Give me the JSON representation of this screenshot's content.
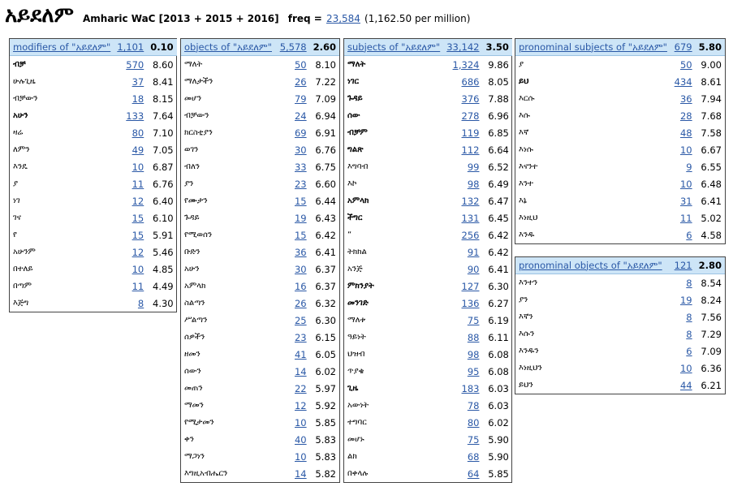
{
  "header": {
    "headword": "አይደለም",
    "corpus": "Amharic WaC [2013 + 2015 + 2016]",
    "freq_label": "freq =",
    "freq_value": "23,584",
    "per_million": "(1,162.50 per million)"
  },
  "panels": [
    {
      "title": "modifiers of \"አይደለም\"",
      "count": "1,101",
      "score": "0.10",
      "rows": [
        {
          "word": "ብቻ",
          "freq": "570",
          "score": "8.60",
          "bold": true
        },
        {
          "word": "ሁሉጊዜ",
          "freq": "37",
          "score": "8.41",
          "bold": false
        },
        {
          "word": "ብቻውን",
          "freq": "18",
          "score": "8.15",
          "bold": false
        },
        {
          "word": "አሁን",
          "freq": "133",
          "score": "7.64",
          "bold": true
        },
        {
          "word": "ዛሬ",
          "freq": "80",
          "score": "7.10",
          "bold": false
        },
        {
          "word": "ለምን",
          "freq": "49",
          "score": "7.05",
          "bold": false
        },
        {
          "word": "እንዴ",
          "freq": "10",
          "score": "6.87",
          "bold": false
        },
        {
          "word": "ያ",
          "freq": "11",
          "score": "6.76",
          "bold": false
        },
        {
          "word": "ነገ",
          "freq": "12",
          "score": "6.40",
          "bold": false
        },
        {
          "word": "ገና",
          "freq": "15",
          "score": "6.10",
          "bold": false
        },
        {
          "word": "የ",
          "freq": "15",
          "score": "5.91",
          "bold": false
        },
        {
          "word": "አሁንም",
          "freq": "12",
          "score": "5.46",
          "bold": false
        },
        {
          "word": "በተለይ",
          "freq": "10",
          "score": "4.85",
          "bold": false
        },
        {
          "word": "በጣም",
          "freq": "11",
          "score": "4.49",
          "bold": false
        },
        {
          "word": "እጅግ",
          "freq": "8",
          "score": "4.30",
          "bold": false
        }
      ]
    },
    {
      "title": "objects of \"አይደለም\"",
      "count": "5,578",
      "score": "2.60",
      "rows": [
        {
          "word": "ማለት",
          "freq": "50",
          "score": "8.10",
          "bold": false
        },
        {
          "word": "ማለታችን",
          "freq": "26",
          "score": "7.22",
          "bold": false
        },
        {
          "word": "መሆን",
          "freq": "79",
          "score": "7.09",
          "bold": false
        },
        {
          "word": "ብቻውን",
          "freq": "24",
          "score": "6.94",
          "bold": false
        },
        {
          "word": "ክርስቲያን",
          "freq": "69",
          "score": "6.91",
          "bold": false
        },
        {
          "word": "ወገን",
          "freq": "30",
          "score": "6.76",
          "bold": false
        },
        {
          "word": "ብለን",
          "freq": "33",
          "score": "6.75",
          "bold": false
        },
        {
          "word": "ያን",
          "freq": "23",
          "score": "6.60",
          "bold": false
        },
        {
          "word": "የሙታን",
          "freq": "15",
          "score": "6.44",
          "bold": false
        },
        {
          "word": "ጉዳይ",
          "freq": "19",
          "score": "6.43",
          "bold": false
        },
        {
          "word": "የሚወሰን",
          "freq": "15",
          "score": "6.42",
          "bold": false
        },
        {
          "word": "ቡድን",
          "freq": "36",
          "score": "6.41",
          "bold": false
        },
        {
          "word": "አሁን",
          "freq": "30",
          "score": "6.37",
          "bold": false
        },
        {
          "word": "አምላክ",
          "freq": "16",
          "score": "6.37",
          "bold": false
        },
        {
          "word": "ስልጣን",
          "freq": "26",
          "score": "6.32",
          "bold": false
        },
        {
          "word": "ሥልጣን",
          "freq": "25",
          "score": "6.30",
          "bold": false
        },
        {
          "word": "ሰዎችን",
          "freq": "23",
          "score": "6.15",
          "bold": false
        },
        {
          "word": "ዘመን",
          "freq": "41",
          "score": "6.05",
          "bold": false
        },
        {
          "word": "ሰውን",
          "freq": "14",
          "score": "6.02",
          "bold": false
        },
        {
          "word": "መጠን",
          "freq": "22",
          "score": "5.97",
          "bold": false
        },
        {
          "word": "ማመን",
          "freq": "12",
          "score": "5.92",
          "bold": false
        },
        {
          "word": "የሚታመን",
          "freq": "10",
          "score": "5.85",
          "bold": false
        },
        {
          "word": "ቀን",
          "freq": "40",
          "score": "5.83",
          "bold": false
        },
        {
          "word": "ማጋነን",
          "freq": "10",
          "score": "5.83",
          "bold": false
        },
        {
          "word": "እግዚአብሔርን",
          "freq": "14",
          "score": "5.82",
          "bold": false
        }
      ]
    },
    {
      "title": "subjects of \"አይደለም\"",
      "count": "33,142",
      "score": "3.50",
      "rows": [
        {
          "word": "ማለት",
          "freq": "1,324",
          "score": "9.86",
          "bold": true
        },
        {
          "word": "ነገር",
          "freq": "686",
          "score": "8.05",
          "bold": true
        },
        {
          "word": "ጉዳይ",
          "freq": "376",
          "score": "7.88",
          "bold": true
        },
        {
          "word": "ሰው",
          "freq": "278",
          "score": "6.96",
          "bold": true
        },
        {
          "word": "ብቻም",
          "freq": "119",
          "score": "6.85",
          "bold": true
        },
        {
          "word": "ግልጽ",
          "freq": "112",
          "score": "6.64",
          "bold": true
        },
        {
          "word": "እግባብ",
          "freq": "99",
          "score": "6.52",
          "bold": false
        },
        {
          "word": "እኮ",
          "freq": "98",
          "score": "6.49",
          "bold": false
        },
        {
          "word": "አምላክ",
          "freq": "132",
          "score": "6.47",
          "bold": true
        },
        {
          "word": "ችግር",
          "freq": "131",
          "score": "6.45",
          "bold": true
        },
        {
          "word": "“",
          "freq": "256",
          "score": "6.42",
          "bold": false
        },
        {
          "word": "ትክክል",
          "freq": "91",
          "score": "6.42",
          "bold": false
        },
        {
          "word": "አንጅ",
          "freq": "90",
          "score": "6.41",
          "bold": false
        },
        {
          "word": "ምክንያት",
          "freq": "127",
          "score": "6.30",
          "bold": true
        },
        {
          "word": "መንገድ",
          "freq": "136",
          "score": "6.27",
          "bold": true
        },
        {
          "word": "ማለቱ",
          "freq": "75",
          "score": "6.19",
          "bold": false
        },
        {
          "word": "ዓይነት",
          "freq": "88",
          "score": "6.11",
          "bold": false
        },
        {
          "word": "ህዝብ",
          "freq": "98",
          "score": "6.08",
          "bold": false
        },
        {
          "word": "ጥያቄ",
          "freq": "95",
          "score": "6.08",
          "bold": false
        },
        {
          "word": "ጊዜ",
          "freq": "183",
          "score": "6.03",
          "bold": true
        },
        {
          "word": "አውነት",
          "freq": "78",
          "score": "6.03",
          "bold": false
        },
        {
          "word": "ተግባር",
          "freq": "80",
          "score": "6.02",
          "bold": false
        },
        {
          "word": "መሆኑ",
          "freq": "75",
          "score": "5.90",
          "bold": false
        },
        {
          "word": "ልክ",
          "freq": "68",
          "score": "5.90",
          "bold": false
        },
        {
          "word": "በቀላሉ",
          "freq": "64",
          "score": "5.85",
          "bold": false
        }
      ]
    },
    {
      "title": "pronominal subjects of \"አይደለም\"",
      "count": "679",
      "score": "5.80",
      "rows": [
        {
          "word": "ያ",
          "freq": "50",
          "score": "9.00",
          "bold": false
        },
        {
          "word": "ይህ",
          "freq": "434",
          "score": "8.61",
          "bold": true
        },
        {
          "word": "እርሱ",
          "freq": "36",
          "score": "7.94",
          "bold": false
        },
        {
          "word": "እሱ",
          "freq": "28",
          "score": "7.68",
          "bold": false
        },
        {
          "word": "እኛ",
          "freq": "48",
          "score": "7.58",
          "bold": false
        },
        {
          "word": "እነሱ",
          "freq": "10",
          "score": "6.67",
          "bold": false
        },
        {
          "word": "እናንተ",
          "freq": "9",
          "score": "6.55",
          "bold": false
        },
        {
          "word": "እንተ",
          "freq": "10",
          "score": "6.48",
          "bold": false
        },
        {
          "word": "እኔ",
          "freq": "31",
          "score": "6.41",
          "bold": false
        },
        {
          "word": "እነዚህ",
          "freq": "11",
          "score": "5.02",
          "bold": false
        },
        {
          "word": "እንዱ",
          "freq": "6",
          "score": "4.58",
          "bold": false
        }
      ]
    },
    {
      "title": "pronominal objects of \"አይደለም\"",
      "count": "121",
      "score": "2.80",
      "rows": [
        {
          "word": "እንተን",
          "freq": "8",
          "score": "8.54",
          "bold": false
        },
        {
          "word": "ያን",
          "freq": "19",
          "score": "8.24",
          "bold": false
        },
        {
          "word": "እኛን",
          "freq": "8",
          "score": "7.56",
          "bold": false
        },
        {
          "word": "እሱን",
          "freq": "8",
          "score": "7.29",
          "bold": false
        },
        {
          "word": "እንዱን",
          "freq": "6",
          "score": "7.09",
          "bold": false
        },
        {
          "word": "እነዚህን",
          "freq": "10",
          "score": "6.36",
          "bold": false
        },
        {
          "word": "ይህን",
          "freq": "44",
          "score": "6.21",
          "bold": false
        }
      ]
    }
  ]
}
